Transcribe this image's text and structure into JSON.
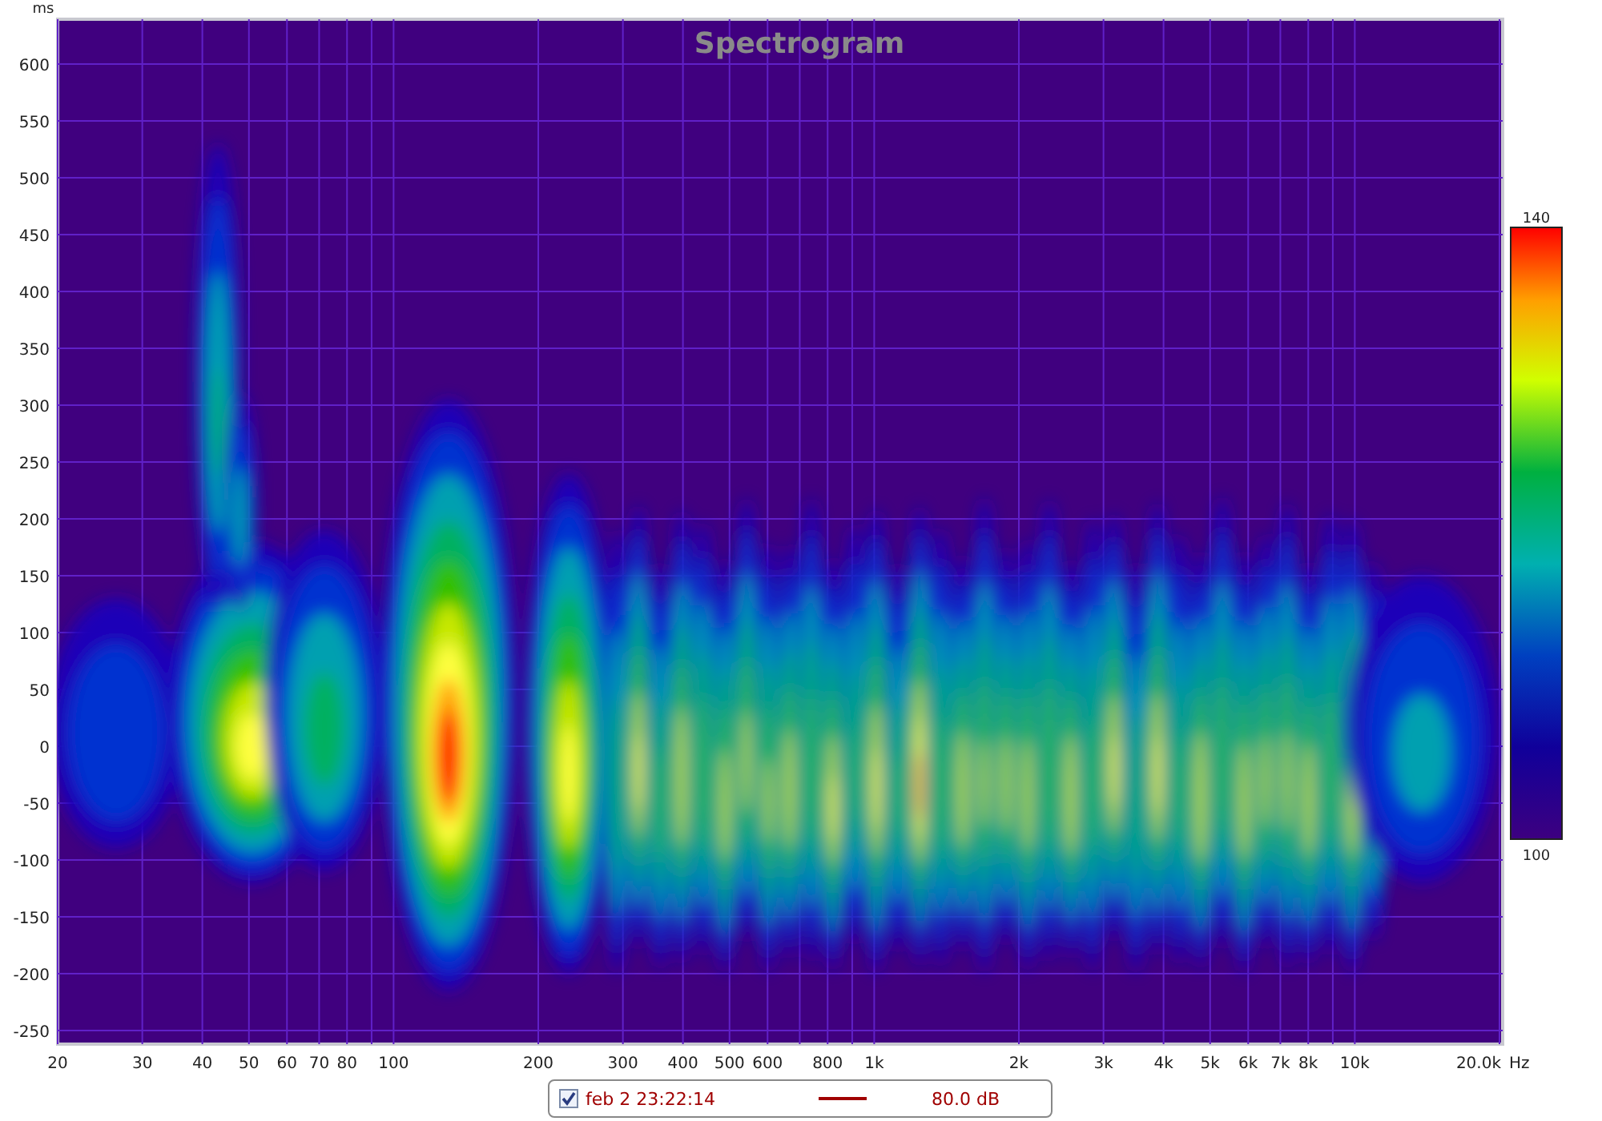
{
  "chart": {
    "title": "Spectrogram",
    "y_unit": "ms",
    "x_unit": "Hz",
    "y_ticks": [
      "600",
      "550",
      "500",
      "450",
      "400",
      "350",
      "300",
      "250",
      "200",
      "150",
      "100",
      "50",
      "0",
      "-50",
      "-100",
      "-150",
      "-200",
      "-250"
    ],
    "x_ticks": [
      "20",
      "30",
      "40",
      "50",
      "60",
      "70",
      "80",
      "100",
      "200",
      "300",
      "400",
      "500",
      "600",
      "800",
      "1k",
      "2k",
      "3k",
      "4k",
      "5k",
      "6k",
      "7k",
      "8k",
      "10k",
      "20.0k"
    ]
  },
  "color_scale": {
    "max": "140",
    "min": "100"
  },
  "legend": [
    {
      "checked": true,
      "label": "feb 2 23:22:14",
      "color": "#a00000",
      "value": "80.0 dB"
    }
  ]
}
